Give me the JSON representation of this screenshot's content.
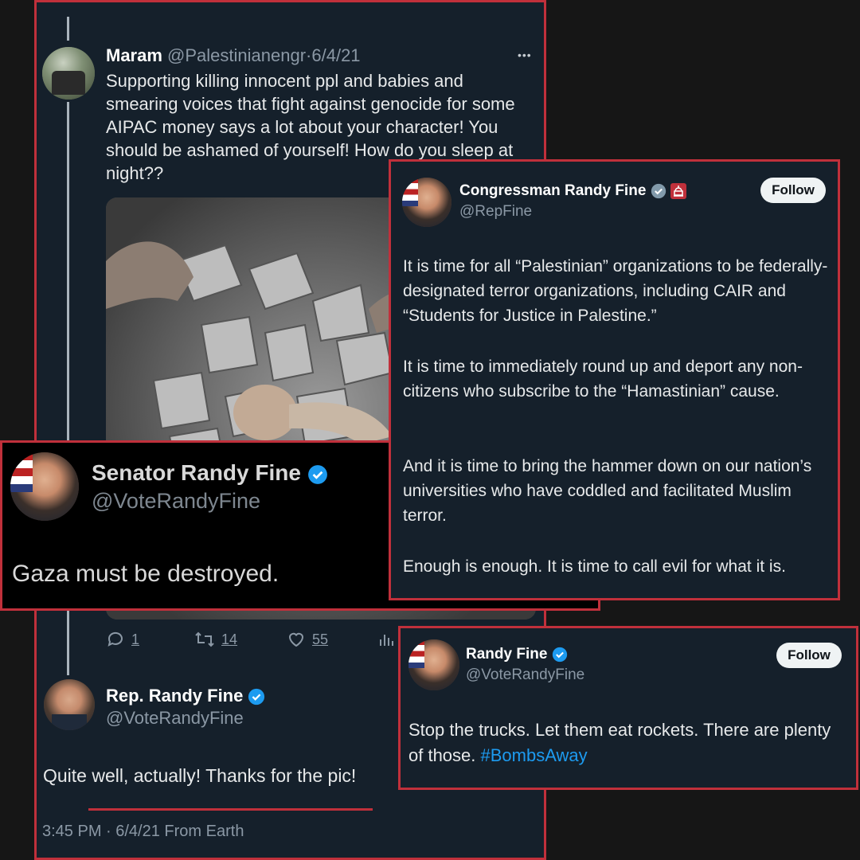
{
  "tweet_maram": {
    "name": "Maram",
    "handle": "@Palestinianengr",
    "sep": "·",
    "date": "6/4/21",
    "more": "•••",
    "text": "Supporting killing innocent ppl and babies and smearing voices that fight against genocide for some AIPAC money says a lot about your character! You should be ashamed of yourself! How do you sleep at night??",
    "stats": {
      "replies": "1",
      "retweets": "14",
      "likes": "55"
    }
  },
  "reply_rep": {
    "name": "Rep. Randy Fine",
    "handle": "@VoteRandyFine",
    "text": "Quite well, actually!  Thanks for the pic!",
    "timestamp": "3:45 PM · 6/4/21 From Earth"
  },
  "tweet_senator": {
    "name": "Senator Randy Fine",
    "handle": "@VoteRandyFine",
    "text": "Gaza must be destroyed."
  },
  "tweet_congressman": {
    "name": "Congressman Randy Fine",
    "handle": "@RepFine",
    "follow": "Follow",
    "p1": "It is time for all “Palestinian” organizations to be federally-designated terror organizations, including CAIR and “Students for Justice in Palestine.”",
    "p2": "It is time to immediately round up and deport any non-citizens who subscribe to the “Hamastinian” cause.",
    "p3": "And it is time to bring the hammer down on our nation’s universities who have coddled and facilitated Muslim terror.",
    "p4": "Enough is enough.  It is time to call evil for what it is."
  },
  "tweet_randy": {
    "name": "Randy Fine",
    "handle": "@VoteRandyFine",
    "follow": "Follow",
    "text": "Stop the trucks.  Let them eat rockets.  There are plenty of those.",
    "hashtag": "#BombsAway"
  },
  "colors": {
    "border": "#c0303b",
    "card_bg": "#15202b",
    "verified": "#1d9bf0",
    "link": "#1d9bf0"
  }
}
